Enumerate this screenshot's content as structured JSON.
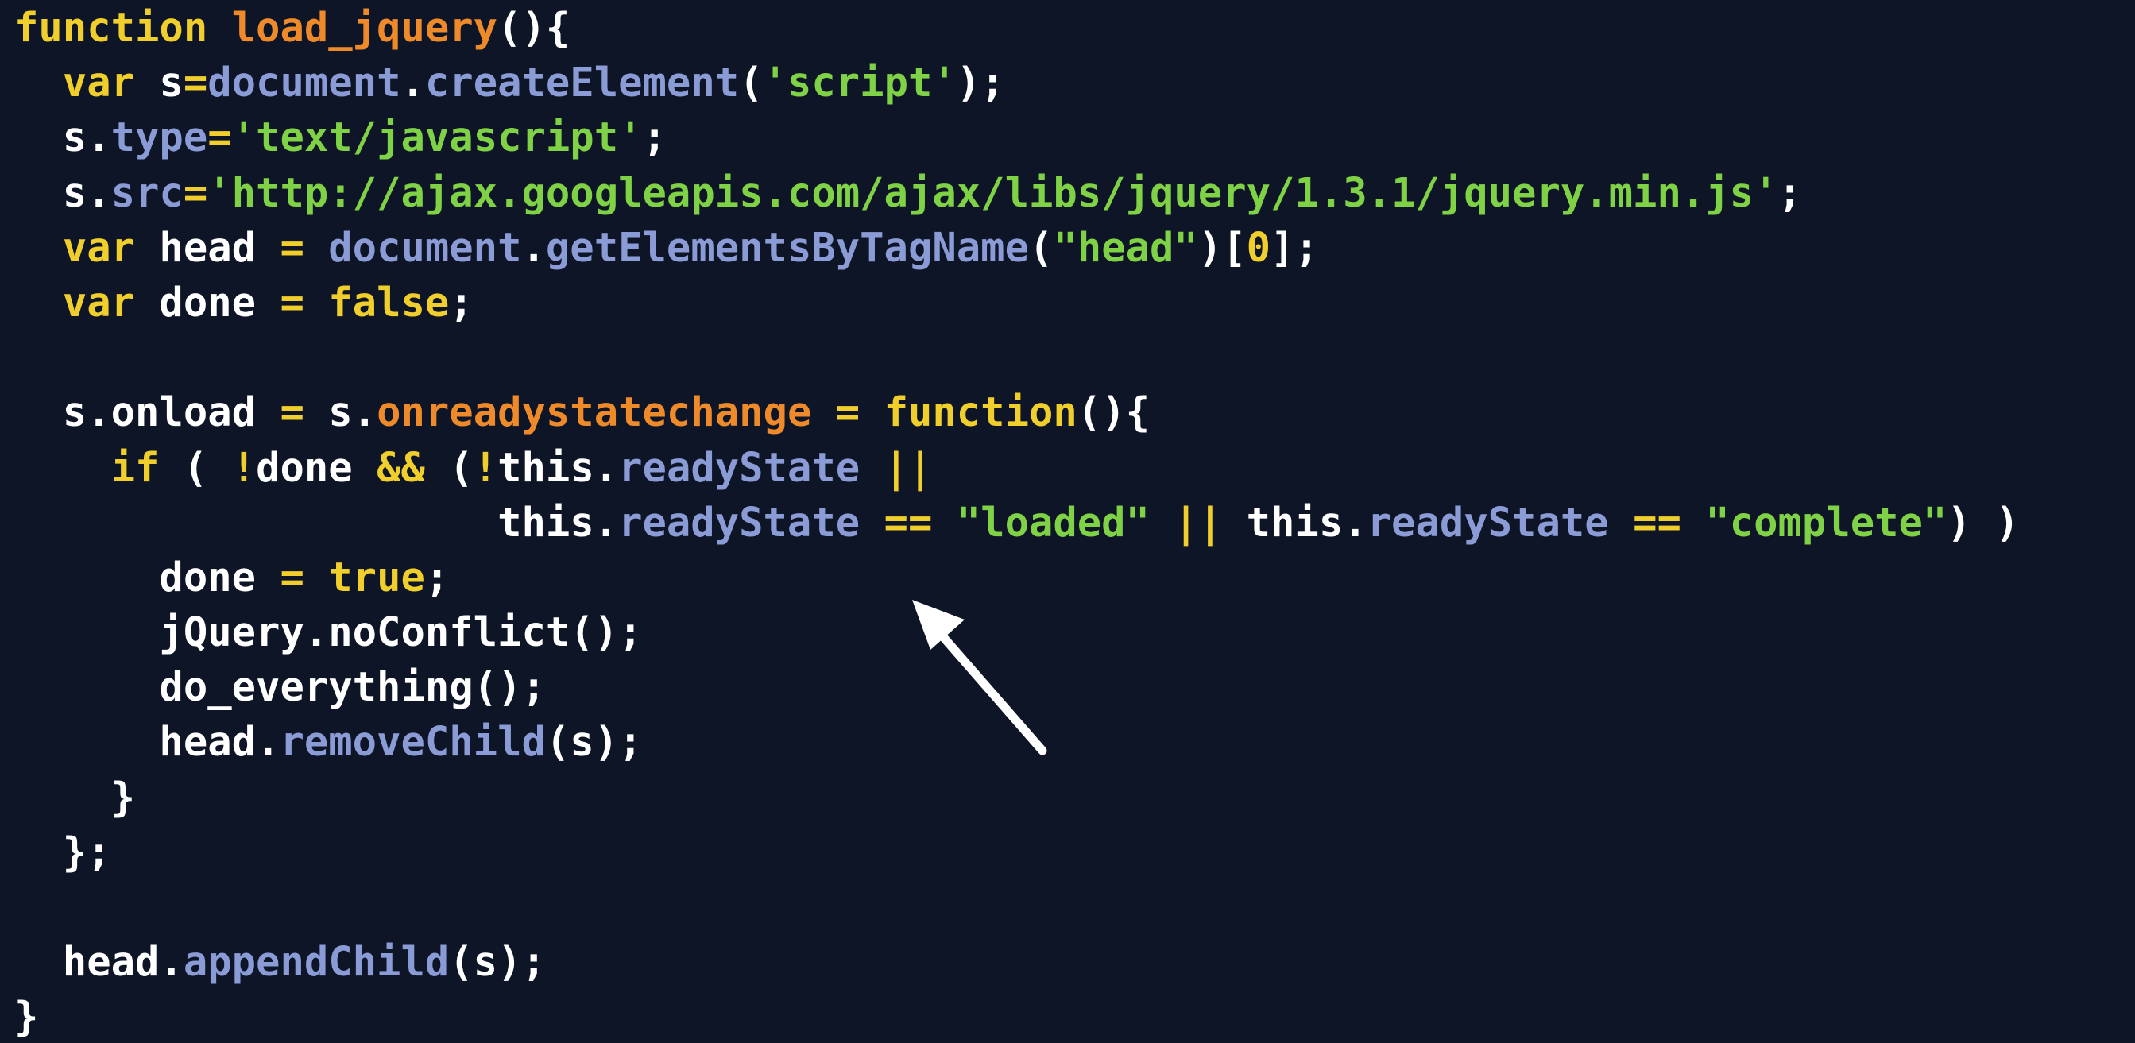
{
  "colors": {
    "background": "#0d1526",
    "keyword": "#f0ce2c",
    "function_name": "#ef8a2b",
    "property": "#8a9bd6",
    "string": "#7fd146",
    "plain": "#ffffff",
    "arrow": "#ffffff"
  },
  "annotation": {
    "icon": "arrow-up-left-icon"
  },
  "code": {
    "lines": [
      [
        {
          "t": "function",
          "c": "kw"
        },
        {
          "t": " ",
          "c": "plain"
        },
        {
          "t": "load_jquery",
          "c": "fn"
        },
        {
          "t": "(){",
          "c": "plain"
        }
      ],
      [
        {
          "t": "  ",
          "c": "plain"
        },
        {
          "t": "var",
          "c": "kw"
        },
        {
          "t": " s",
          "c": "plain"
        },
        {
          "t": "=",
          "c": "kw"
        },
        {
          "t": "document",
          "c": "prop"
        },
        {
          "t": ".",
          "c": "plain"
        },
        {
          "t": "createElement",
          "c": "prop"
        },
        {
          "t": "(",
          "c": "plain"
        },
        {
          "t": "'script'",
          "c": "str"
        },
        {
          "t": ");",
          "c": "plain"
        }
      ],
      [
        {
          "t": "  s.",
          "c": "plain"
        },
        {
          "t": "type",
          "c": "prop"
        },
        {
          "t": "=",
          "c": "kw"
        },
        {
          "t": "'text/javascript'",
          "c": "str"
        },
        {
          "t": ";",
          "c": "plain"
        }
      ],
      [
        {
          "t": "  s.",
          "c": "plain"
        },
        {
          "t": "src",
          "c": "prop"
        },
        {
          "t": "=",
          "c": "kw"
        },
        {
          "t": "'http://ajax.googleapis.com/ajax/libs/jquery/1.3.1/jquery.min.js'",
          "c": "str"
        },
        {
          "t": ";",
          "c": "plain"
        }
      ],
      [
        {
          "t": "  ",
          "c": "plain"
        },
        {
          "t": "var",
          "c": "kw"
        },
        {
          "t": " head ",
          "c": "plain"
        },
        {
          "t": "=",
          "c": "kw"
        },
        {
          "t": " ",
          "c": "plain"
        },
        {
          "t": "document",
          "c": "prop"
        },
        {
          "t": ".",
          "c": "plain"
        },
        {
          "t": "getElementsByTagName",
          "c": "prop"
        },
        {
          "t": "(",
          "c": "plain"
        },
        {
          "t": "\"head\"",
          "c": "str"
        },
        {
          "t": ")[",
          "c": "plain"
        },
        {
          "t": "0",
          "c": "num"
        },
        {
          "t": "];",
          "c": "plain"
        }
      ],
      [
        {
          "t": "  ",
          "c": "plain"
        },
        {
          "t": "var",
          "c": "kw"
        },
        {
          "t": " done ",
          "c": "plain"
        },
        {
          "t": "=",
          "c": "kw"
        },
        {
          "t": " ",
          "c": "plain"
        },
        {
          "t": "false",
          "c": "kw"
        },
        {
          "t": ";",
          "c": "plain"
        }
      ],
      [
        {
          "t": "",
          "c": "plain"
        }
      ],
      [
        {
          "t": "  s.onload ",
          "c": "plain"
        },
        {
          "t": "=",
          "c": "kw"
        },
        {
          "t": " s.",
          "c": "plain"
        },
        {
          "t": "onreadystatechange",
          "c": "fn"
        },
        {
          "t": " ",
          "c": "plain"
        },
        {
          "t": "=",
          "c": "kw"
        },
        {
          "t": " ",
          "c": "plain"
        },
        {
          "t": "function",
          "c": "kw"
        },
        {
          "t": "(){",
          "c": "plain"
        }
      ],
      [
        {
          "t": "    ",
          "c": "plain"
        },
        {
          "t": "if",
          "c": "kw"
        },
        {
          "t": " ( ",
          "c": "plain"
        },
        {
          "t": "!",
          "c": "kw"
        },
        {
          "t": "done ",
          "c": "plain"
        },
        {
          "t": "&&",
          "c": "kw"
        },
        {
          "t": " (",
          "c": "plain"
        },
        {
          "t": "!",
          "c": "kw"
        },
        {
          "t": "this.",
          "c": "plain"
        },
        {
          "t": "readyState",
          "c": "prop"
        },
        {
          "t": " ",
          "c": "plain"
        },
        {
          "t": "||",
          "c": "kw"
        }
      ],
      [
        {
          "t": "                    this.",
          "c": "plain"
        },
        {
          "t": "readyState",
          "c": "prop"
        },
        {
          "t": " ",
          "c": "plain"
        },
        {
          "t": "==",
          "c": "kw"
        },
        {
          "t": " ",
          "c": "plain"
        },
        {
          "t": "\"loaded\"",
          "c": "str"
        },
        {
          "t": " ",
          "c": "plain"
        },
        {
          "t": "||",
          "c": "kw"
        },
        {
          "t": " this.",
          "c": "plain"
        },
        {
          "t": "readyState",
          "c": "prop"
        },
        {
          "t": " ",
          "c": "plain"
        },
        {
          "t": "==",
          "c": "kw"
        },
        {
          "t": " ",
          "c": "plain"
        },
        {
          "t": "\"complete\"",
          "c": "str"
        },
        {
          "t": ") )",
          "c": "plain"
        }
      ],
      [
        {
          "t": "      done ",
          "c": "plain"
        },
        {
          "t": "=",
          "c": "kw"
        },
        {
          "t": " ",
          "c": "plain"
        },
        {
          "t": "true",
          "c": "kw"
        },
        {
          "t": ";",
          "c": "plain"
        }
      ],
      [
        {
          "t": "      jQuery.noConflict();",
          "c": "plain"
        }
      ],
      [
        {
          "t": "      do_everything();",
          "c": "plain"
        }
      ],
      [
        {
          "t": "      head.",
          "c": "plain"
        },
        {
          "t": "removeChild",
          "c": "prop"
        },
        {
          "t": "(s);",
          "c": "plain"
        }
      ],
      [
        {
          "t": "    }",
          "c": "plain"
        }
      ],
      [
        {
          "t": "  };",
          "c": "plain"
        }
      ],
      [
        {
          "t": "",
          "c": "plain"
        }
      ],
      [
        {
          "t": "  head.",
          "c": "plain"
        },
        {
          "t": "appendChild",
          "c": "prop"
        },
        {
          "t": "(s);",
          "c": "plain"
        }
      ],
      [
        {
          "t": "}",
          "c": "plain"
        }
      ]
    ]
  }
}
